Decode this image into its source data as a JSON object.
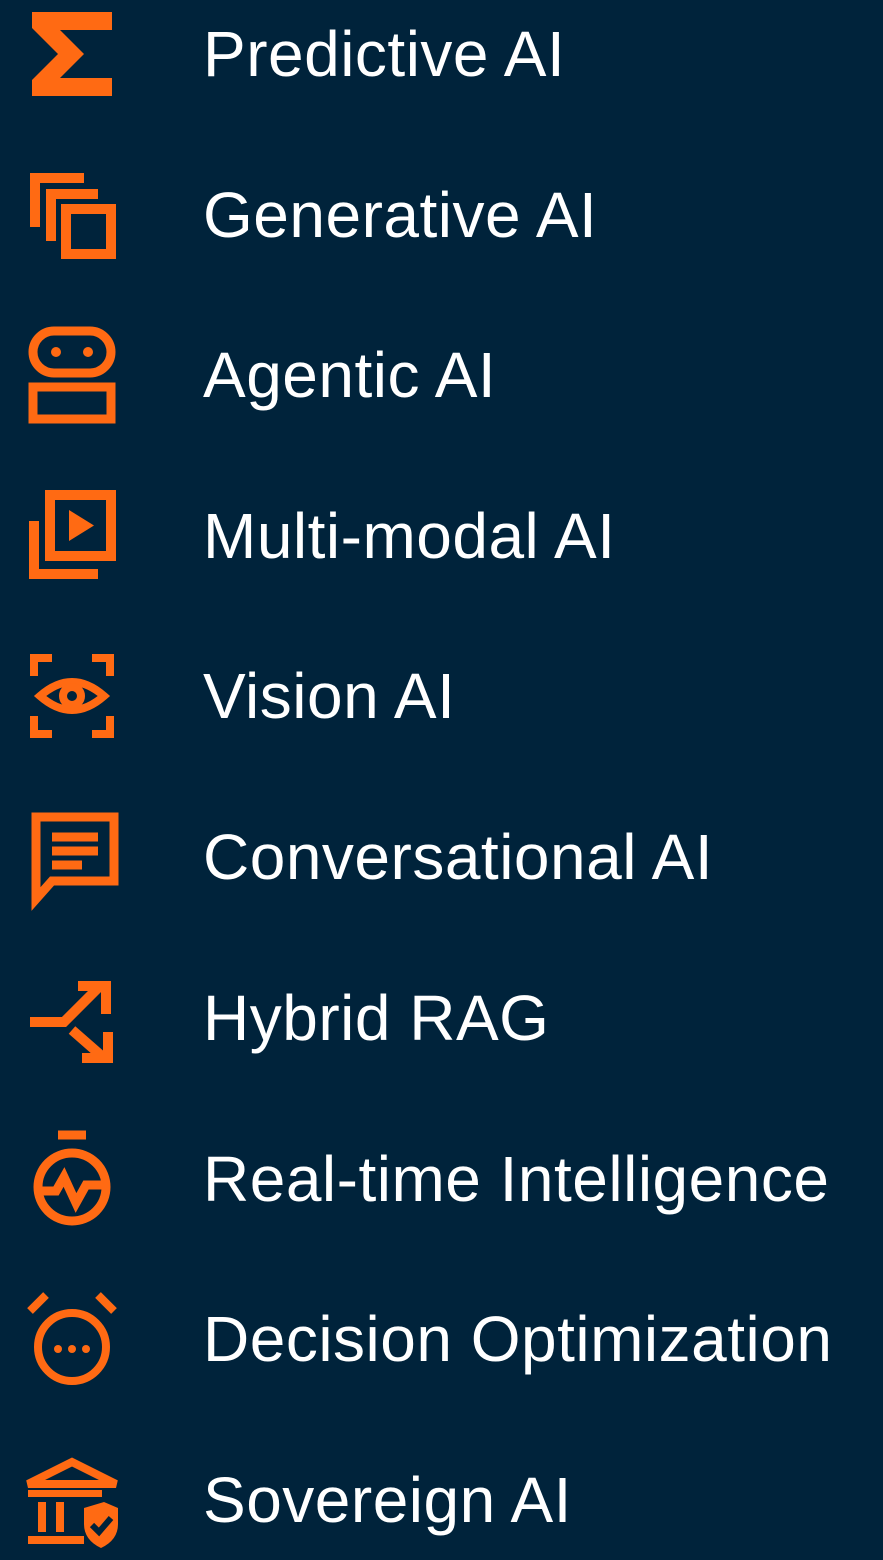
{
  "colors": {
    "background": "#00233b",
    "accent": "#ff6a13",
    "text": "#ffffff"
  },
  "items": [
    {
      "label": "Predictive AI",
      "icon": "sigma-icon"
    },
    {
      "label": "Generative AI",
      "icon": "copy-layers-icon"
    },
    {
      "label": "Agentic AI",
      "icon": "robot-icon"
    },
    {
      "label": "Multi-modal AI",
      "icon": "video-library-icon"
    },
    {
      "label": "Vision AI",
      "icon": "eye-scan-icon"
    },
    {
      "label": "Conversational AI",
      "icon": "chat-bubble-icon"
    },
    {
      "label": "Hybrid RAG",
      "icon": "merge-arrows-icon"
    },
    {
      "label": "Real-time Intelligence",
      "icon": "stopwatch-pulse-icon"
    },
    {
      "label": "Decision Optimization",
      "icon": "alarm-clock-icon"
    },
    {
      "label": "Sovereign AI",
      "icon": "bank-shield-icon"
    }
  ]
}
